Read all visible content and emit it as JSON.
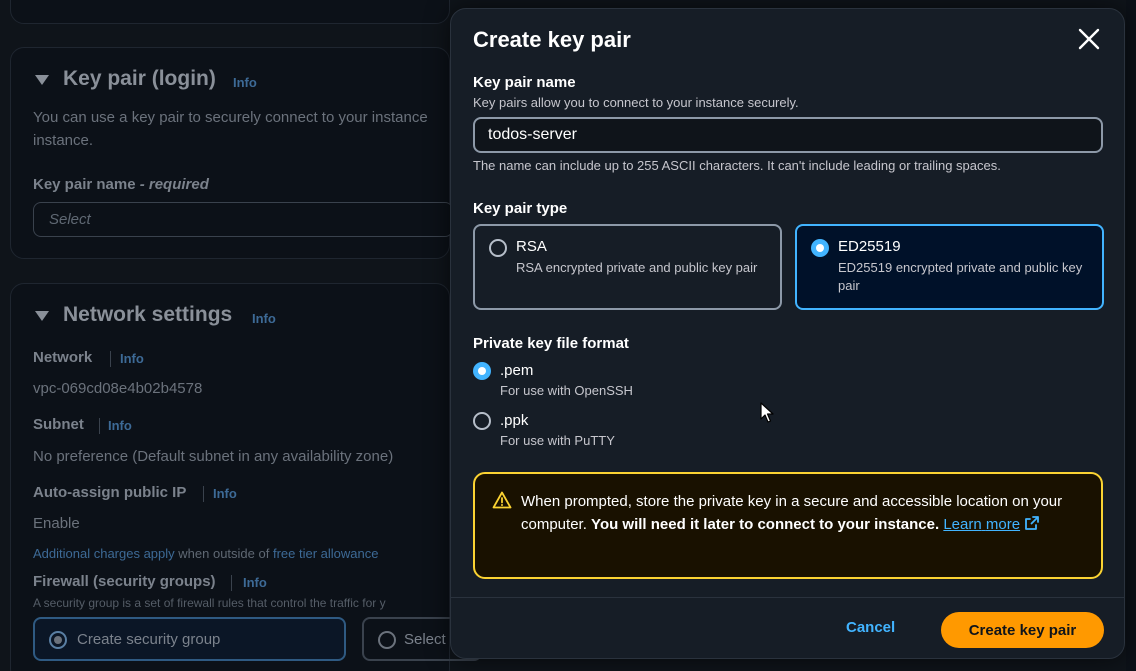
{
  "background": {
    "keypair_section": {
      "title": "Key pair (login)",
      "info": "Info",
      "description_line1": "You can use a key pair to securely connect to your instance",
      "description_line2": "instance.",
      "name_label": "Key pair name",
      "name_required": "- required",
      "select_placeholder": "Select"
    },
    "network_section": {
      "title": "Network settings",
      "info": "Info",
      "network_label": "Network",
      "network_info": "Info",
      "network_value": "vpc-069cd08e4b02b4578",
      "subnet_label": "Subnet",
      "subnet_info": "Info",
      "subnet_value": "No preference (Default subnet in any availability zone)",
      "public_ip_label": "Auto-assign public IP",
      "public_ip_info": "Info",
      "public_ip_value": "Enable",
      "charges_link": "Additional charges apply",
      "charges_middle": " when outside of ",
      "free_tier_link": "free tier allowance",
      "firewall_label": "Firewall (security groups)",
      "firewall_info": "Info",
      "firewall_desc": "A security group is a set of firewall rules that control the traffic for y",
      "create_sg": "Create security group",
      "select_sg": "Select"
    }
  },
  "modal": {
    "title": "Create key pair",
    "name_label": "Key pair name",
    "name_desc": "Key pairs allow you to connect to your instance securely.",
    "name_value": "todos-server",
    "name_hint": "The name can include up to 255 ASCII characters. It can't include leading or trailing spaces.",
    "type_label": "Key pair type",
    "types": [
      {
        "name": "RSA",
        "desc": "RSA encrypted private and public key pair",
        "selected": false
      },
      {
        "name": "ED25519",
        "desc": "ED25519 encrypted private and public key pair",
        "selected": true
      }
    ],
    "format_label": "Private key file format",
    "formats": [
      {
        "name": ".pem",
        "desc": "For use with OpenSSH",
        "selected": true
      },
      {
        "name": ".ppk",
        "desc": "For use with PuTTY",
        "selected": false
      }
    ],
    "warning": {
      "text": "When prompted, store the private key in a secure and accessible location on your computer. ",
      "bold": "You will need it later to connect to your instance.",
      "link1": "Learn",
      "link2": "more"
    },
    "cancel_label": "Cancel",
    "create_label": "Create key pair"
  },
  "colors": {
    "accent": "#42b4ff",
    "primary_button": "#ff9900",
    "warning_border": "#fbd332"
  }
}
